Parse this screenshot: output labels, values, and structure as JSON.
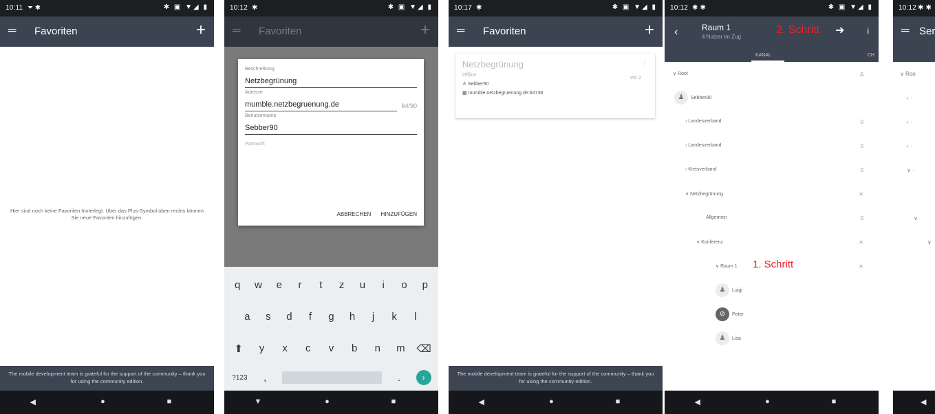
{
  "screens": [
    {
      "status": {
        "time": "10:11",
        "left_icons": "⏷ ✱",
        "right_icons": "✱ ▣ ▼◢ ▮"
      },
      "appbar": {
        "menu": "═",
        "title": "Favoriten",
        "plus": "+"
      },
      "empty_message": "Hier sind noch keine Favoriten hinterlegt. Über das Plus-Symbol oben rechts können Sie neue Favoriten hinzufügen.",
      "banner": "The mobile development team is grateful for the support of the community – thank you for using the community edition.",
      "nav": {
        "back": "◀",
        "home": "●",
        "recent": "■"
      }
    },
    {
      "status": {
        "time": "10:12",
        "left_icons": "✱",
        "right_icons": "✱ ▣ ▼◢ ▮"
      },
      "appbar": {
        "menu": "═",
        "title": "Favoriten",
        "plus": "+"
      },
      "dialog": {
        "label_description": "Beschreibung",
        "value_description": "Netzbegrünung",
        "label_address": "Adresse",
        "value_address": "mumble.netzbegruenung.de",
        "counter": "64/90",
        "label_username": "Benutzername",
        "value_username": "Sebber90",
        "label_password": "Passwort",
        "action_cancel": "ABBRECHEN",
        "action_add": "HINZUFÜGEN"
      },
      "keyboard": {
        "row1": [
          "q",
          "w",
          "e",
          "r",
          "t",
          "z",
          "u",
          "i",
          "o",
          "p"
        ],
        "row2": [
          "a",
          "s",
          "d",
          "f",
          "g",
          "h",
          "j",
          "k",
          "l"
        ],
        "row3_shift": "⬆",
        "row3": [
          "y",
          "x",
          "c",
          "v",
          "b",
          "n",
          "m"
        ],
        "row3_delete": "⌫",
        "row4_symbols": "?123",
        "row4_comma": ",",
        "row4_period": ".",
        "row4_enter": "›"
      },
      "nav": {
        "back": "▼",
        "home": "●",
        "recent": "■"
      }
    },
    {
      "status": {
        "time": "10:17",
        "left_icons": "✱",
        "right_icons": "✱ ▣ ▼◢ ▮"
      },
      "appbar": {
        "menu": "═",
        "title": "Favoriten",
        "plus": "+"
      },
      "card": {
        "title": "Netzbegrünung",
        "subtitle": "Offline",
        "meta": "Vor 2",
        "more": "⋮",
        "user": "≗ Sebber90",
        "address": "▦ mumble.netzbegruenung.de:64738"
      },
      "banner": "The mobile development team is grateful for the support of the community – thank you for using the community edition.",
      "nav": {
        "back": "◀",
        "home": "●",
        "recent": "■"
      }
    },
    {
      "status": {
        "time": "10:12",
        "left_icons": "✱ ✱",
        "right_icons": "✱ ▣ ▼◢ ▮"
      },
      "appbar": {
        "back": "‹",
        "title": "Raum 1",
        "subtitle": "4 Nutzer im Zug",
        "step2": "2. Schritt",
        "arrow": "➜",
        "info": "i"
      },
      "tabs": {
        "tab1": "KANAL",
        "tab2": "CH"
      },
      "tree": [
        {
          "label": "Root",
          "right": "∆"
        },
        {
          "label": "Sebber90",
          "right": ""
        },
        {
          "label": "Landesverband",
          "right": "0"
        },
        {
          "label": "Landesverband",
          "right": "0"
        },
        {
          "label": "Kreisverband",
          "right": "0"
        },
        {
          "label": "Netzbegrünung",
          "right": "✕"
        },
        {
          "label": "Allgemein",
          "right": "0"
        },
        {
          "label": "Konferenz",
          "right": "✕"
        },
        {
          "label": "Raum 1",
          "right": "✕",
          "annotation": "1. Schritt"
        },
        {
          "label": "Luigi",
          "right": ""
        },
        {
          "label": "Peter",
          "right": ""
        },
        {
          "label": "Lisa",
          "right": ""
        }
      ],
      "nav": {
        "back": "◀",
        "home": "●",
        "recent": "■"
      }
    },
    {
      "status": {
        "time": "10:12",
        "left_icons": "✱ ✱"
      },
      "appbar": {
        "menu": "═",
        "title": "Ser"
      },
      "tree": [
        {
          "label": "∨ Roo"
        },
        {
          "label": "› ·"
        },
        {
          "label": "› ·"
        },
        {
          "label": "› ·"
        },
        {
          "label": "∨ ·"
        },
        {
          "label": ""
        },
        {
          "label": "∨"
        },
        {
          "label": "∨"
        }
      ],
      "nav": {
        "back": "◀"
      }
    }
  ]
}
